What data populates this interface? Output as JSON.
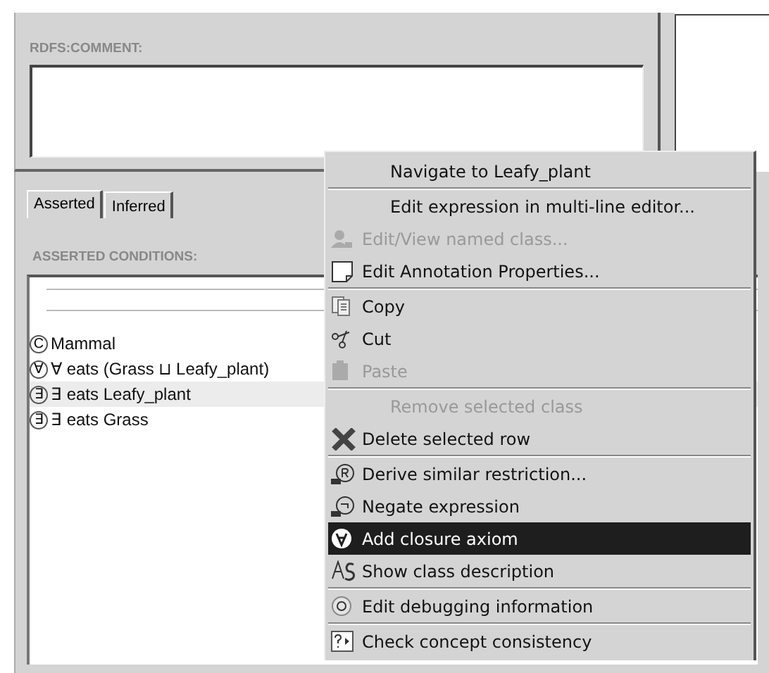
{
  "comment_panel": {
    "label": "RDFS:COMMENT:"
  },
  "tabs": [
    {
      "label": "Asserted",
      "selected": true
    },
    {
      "label": "Inferred",
      "selected": false
    }
  ],
  "conditions": {
    "label": "ASSERTED CONDITIONS:",
    "rows": [
      {
        "symbol": "C",
        "text": "Mammal",
        "selected": false
      },
      {
        "symbol": "∀",
        "text": "∀ eats (Grass ⊔ Leafy_plant)",
        "selected": false
      },
      {
        "symbol": "∃",
        "text": "∃ eats Leafy_plant",
        "selected": true
      },
      {
        "symbol": "∃",
        "text": "∃ eats Grass",
        "selected": false
      }
    ]
  },
  "context_menu": {
    "groups": [
      {
        "items": [
          {
            "label": "Navigate to Leafy_plant",
            "kind": "plain",
            "disabled": false,
            "selected": false
          }
        ]
      },
      {
        "items": [
          {
            "label": "Edit expression in multi-line editor...",
            "kind": "plain",
            "disabled": false,
            "selected": false
          },
          {
            "label": "Edit/View named class...",
            "kind": "person",
            "disabled": true,
            "selected": false
          },
          {
            "label": "Edit Annotation Properties...",
            "kind": "note",
            "disabled": false,
            "selected": false
          }
        ]
      },
      {
        "items": [
          {
            "label": "Copy",
            "kind": "copy",
            "disabled": false,
            "selected": false
          },
          {
            "label": "Cut",
            "kind": "cut",
            "disabled": false,
            "selected": false
          },
          {
            "label": "Paste",
            "kind": "paste",
            "disabled": true,
            "selected": false
          }
        ]
      },
      {
        "items": [
          {
            "label": "Remove selected class",
            "kind": "plain",
            "disabled": true,
            "selected": false
          },
          {
            "label": "Delete selected row",
            "kind": "delete",
            "disabled": false,
            "selected": false
          }
        ]
      },
      {
        "items": [
          {
            "label": "Derive similar restriction...",
            "kind": "derive",
            "disabled": false,
            "selected": false
          },
          {
            "label": "Negate expression",
            "kind": "negate",
            "disabled": false,
            "selected": false
          },
          {
            "label": "Add closure axiom",
            "kind": "closure",
            "disabled": false,
            "selected": true
          },
          {
            "label": "Show class description",
            "kind": "describe",
            "disabled": false,
            "selected": false
          }
        ]
      },
      {
        "items": [
          {
            "label": "Edit debugging information",
            "kind": "debug",
            "disabled": false,
            "selected": false
          }
        ]
      },
      {
        "items": [
          {
            "label": "Check concept consistency",
            "kind": "check",
            "disabled": false,
            "selected": false
          }
        ]
      }
    ]
  }
}
